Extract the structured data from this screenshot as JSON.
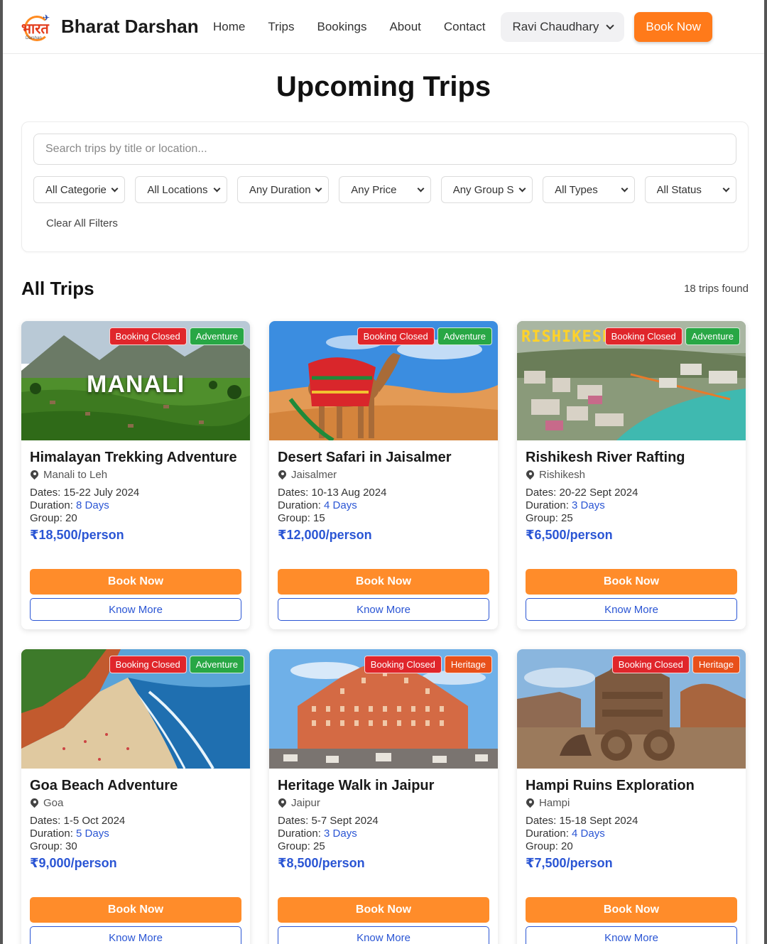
{
  "header": {
    "logo_text": "भारत",
    "logo_subtext": "Darshan",
    "brand": "Bharat Darshan",
    "nav": [
      "Home",
      "Trips",
      "Bookings",
      "About",
      "Contact"
    ],
    "user": "Ravi Chaudhary",
    "book_now": "Book Now"
  },
  "page_title": "Upcoming Trips",
  "filters": {
    "search_placeholder": "Search trips by title or location...",
    "selects": [
      "All Categories",
      "All Locations",
      "Any Duration",
      "Any Price",
      "Any Group Size",
      "All Types",
      "All Status"
    ],
    "clear": "Clear All Filters"
  },
  "section": {
    "title": "All Trips",
    "count": "18 trips found"
  },
  "labels": {
    "dates": "Dates:",
    "duration": "Duration:",
    "group": "Group:",
    "book": "Book Now",
    "more": "Know More"
  },
  "trips": [
    {
      "title": "Himalayan Trekking Adventure",
      "location": "Manali to Leh",
      "dates": "15-22 July 2024",
      "duration": "8 Days",
      "group": "20",
      "price": "₹18,500/person",
      "badges": [
        "Booking Closed",
        "Adventure"
      ],
      "overlay": "MANALI"
    },
    {
      "title": "Desert Safari in Jaisalmer",
      "location": "Jaisalmer",
      "dates": "10-13 Aug 2024",
      "duration": "4 Days",
      "group": "15",
      "price": "₹12,000/person",
      "badges": [
        "Booking Closed",
        "Adventure"
      ],
      "overlay": ""
    },
    {
      "title": "Rishikesh River Rafting",
      "location": "Rishikesh",
      "dates": "20-22 Sept 2024",
      "duration": "3 Days",
      "group": "25",
      "price": "₹6,500/person",
      "badges": [
        "Booking Closed",
        "Adventure"
      ],
      "overlay": "RISHIKESH"
    },
    {
      "title": "Goa Beach Adventure",
      "location": "Goa",
      "dates": "1-5 Oct 2024",
      "duration": "5 Days",
      "group": "30",
      "price": "₹9,000/person",
      "badges": [
        "Booking Closed",
        "Adventure"
      ],
      "overlay": ""
    },
    {
      "title": "Heritage Walk in Jaipur",
      "location": "Jaipur",
      "dates": "5-7 Sept 2024",
      "duration": "3 Days",
      "group": "25",
      "price": "₹8,500/person",
      "badges": [
        "Booking Closed",
        "Heritage"
      ],
      "overlay": ""
    },
    {
      "title": "Hampi Ruins Exploration",
      "location": "Hampi",
      "dates": "15-18 Sept 2024",
      "duration": "4 Days",
      "group": "20",
      "price": "₹7,500/person",
      "badges": [
        "Booking Closed",
        "Heritage"
      ],
      "overlay": ""
    }
  ],
  "colors": {
    "accent": "#ff7a1a",
    "link_blue": "#2a55d4",
    "closed_red": "#e0262b",
    "adventure_green": "#28a745",
    "heritage_orange": "#e8501a"
  }
}
